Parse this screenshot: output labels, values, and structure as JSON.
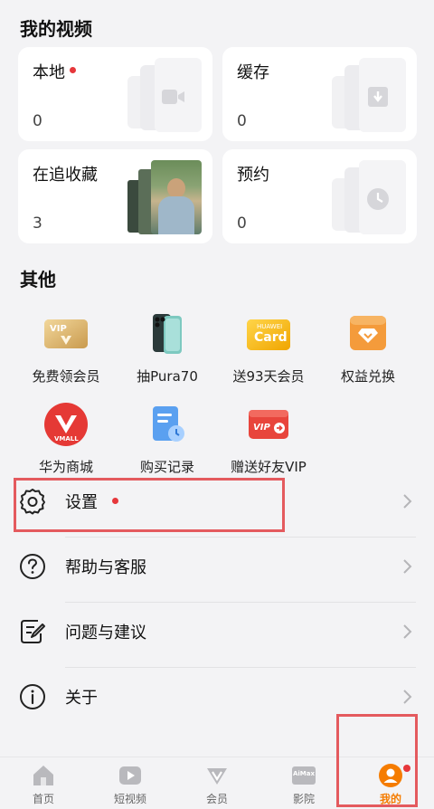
{
  "my_videos": {
    "title": "我的视频",
    "cards": [
      {
        "label": "本地",
        "count": "0",
        "has_dot": true,
        "icon": "video-camera-icon"
      },
      {
        "label": "缓存",
        "count": "0",
        "has_dot": false,
        "icon": "download-icon"
      },
      {
        "label": "在追收藏",
        "count": "3",
        "has_dot": false,
        "icon": "poster-thumbnail"
      },
      {
        "label": "预约",
        "count": "0",
        "has_dot": false,
        "icon": "clock-icon"
      }
    ]
  },
  "other": {
    "title": "其他",
    "items": [
      {
        "label": "免费领会员",
        "icon": "vip-card-icon"
      },
      {
        "label": "抽Pura70",
        "icon": "phone-icon"
      },
      {
        "label": "送93天会员",
        "icon": "huawei-card-icon"
      },
      {
        "label": "权益兑换",
        "icon": "exchange-icon"
      },
      {
        "label": "华为商城",
        "icon": "vmall-icon"
      },
      {
        "label": "购买记录",
        "icon": "purchase-record-icon"
      },
      {
        "label": "赠送好友VIP",
        "icon": "gift-vip-icon"
      }
    ],
    "icon_text": {
      "vip": "VIP",
      "huawei": "HUAWEI",
      "card": "Card",
      "vmall": "VMALL",
      "gift_vip": "VIP"
    }
  },
  "settings_rows": [
    {
      "label": "设置",
      "icon": "gear-icon",
      "has_dot": true
    },
    {
      "label": "帮助与客服",
      "icon": "help-icon",
      "has_dot": false
    },
    {
      "label": "问题与建议",
      "icon": "feedback-icon",
      "has_dot": false
    },
    {
      "label": "关于",
      "icon": "info-icon",
      "has_dot": false
    }
  ],
  "tabbar": {
    "tabs": [
      {
        "label": "首页",
        "icon": "home-icon",
        "active": false
      },
      {
        "label": "短视频",
        "icon": "short-video-icon",
        "active": false
      },
      {
        "label": "会员",
        "icon": "vip-icon",
        "active": false
      },
      {
        "label": "影院",
        "icon": "cinema-icon",
        "active": false,
        "icon_text": "AiMax"
      },
      {
        "label": "我的",
        "icon": "profile-icon",
        "active": true
      }
    ]
  },
  "colors": {
    "accent": "#f57c00",
    "dot": "#e6373b",
    "highlight": "#e45a5e"
  }
}
